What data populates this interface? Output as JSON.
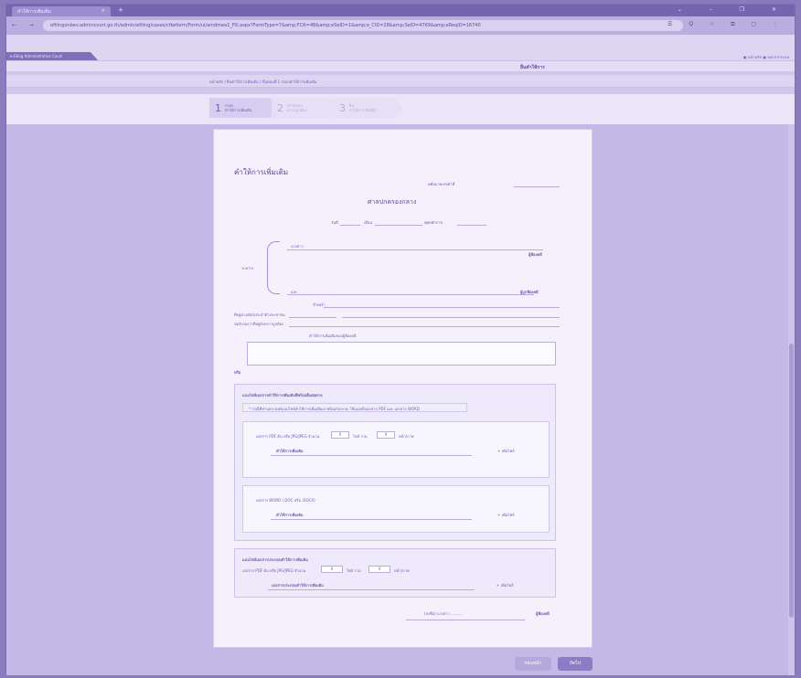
{
  "browser": {
    "tab_title": "คำให้การเพิ่มเติม",
    "tab_close": "×",
    "new_tab": "+",
    "window_controls": "⌄  –  ❐  ✕",
    "url": "efilingonbev.admincourt.go.th/admin/efiling/cases/cfkeform/Form/ui/amdmea1_Fill.aspx?FormType=7&amp;FCR=4B&amp;eSeID=1&amp;e_CID=28&amp;SeID=4769&amp;eReqID=16740",
    "toolbar_icons": "☰ Q ☆ ⧉ ▢ ⋮"
  },
  "app": {
    "brand": "e-Filing Administrative Court",
    "user_links": "▣ หน้าหลัก ▣ ออกจากระบบ",
    "page_title": "ยื่นคำให้การ",
    "breadcrumb": "หน้าหลัก / ยื่นคำให้การเพิ่มเติม / ขั้นตอนที่ 1 กรอกคำให้การเพิ่มเติม"
  },
  "steps": [
    {
      "num": "1",
      "label": "กรอก\nคำให้การเพิ่มเติม"
    },
    {
      "num": "2",
      "label": "ตรวจสอบ\nความถูกต้อง"
    },
    {
      "num": "3",
      "label": "ยื่น\nคำให้การเพิ่มเติม"
    }
  ],
  "form": {
    "title": "คำให้การเพิ่มเติม",
    "case_no_label": "คดีหมายเลขดำที่",
    "court_name": "ศาลปกครองกลาง",
    "date_day": "วันที่",
    "date_month": "เดือน",
    "date_year": "พุทธศักราช",
    "between": "ระหว่าง",
    "party_top": "นางสาว",
    "plaintiff": "ผู้ฟ้องคดี",
    "party_bottom": "และ",
    "defendant": "ผู้ถูกฟ้องคดี",
    "i_label": "ข้าพเจ้า",
    "address_label": "ที่อยู่ตามบัตรประจำตัวประชาชน",
    "contact_label": "ขอรับรองว่าที่อยู่ดังกล่าวถูกต้อง",
    "statement_label": "คำให้การเพิ่มเติมของผู้ฟ้องคดี",
    "or_label": "หรือ",
    "attach_section_title": "แนบไฟล์เอกสารคำให้การเพิ่มเติมที่พร้อมยื่นต่อศาล",
    "attach_note": "* กรณีที่ท่านประสงค์แนบไฟล์คำให้การเพิ่มเติมมาพร้อมกับระบบ ให้แนบทั้งเอกสาร PDF และ เอกสาร WORD",
    "pdf_label": "เอกสาร PDF ต้น หรือ JPG/JPEG จำนวน",
    "pdf_count": "0",
    "pdf_files": "ไฟล์ รวม",
    "pdf_pages": "0",
    "pdf_pages_unit": "หน้า/ภาพ",
    "pdf_item": "คำให้การเพิ่มเติม",
    "add_file": "+ เพิ่มไฟล์",
    "word_label": "เอกสาร WORD (.DOC หรือ .DOCX)",
    "word_item": "คำให้การเพิ่มเติม",
    "evidence_section_title": "แนบไฟล์เอกสารประกอบคำให้การเพิ่มเติม",
    "evidence_label": "เอกสาร PDF ต้น หรือ JPG/JPEG จำนวน",
    "evidence_count": "0",
    "evidence_files": "ไฟล์ รวม",
    "evidence_pages": "0",
    "evidence_pages_unit": "หน้า/ภาพ",
    "evidence_item": "เอกสารประกอบคำให้การเพิ่มเติม",
    "signer": "(ลงชื่อ) นางสาว ..........",
    "signer_role": "ผู้ฟ้องคดี"
  },
  "buttons": {
    "back": "ก่อนหน้า",
    "next": "ถัดไป"
  }
}
